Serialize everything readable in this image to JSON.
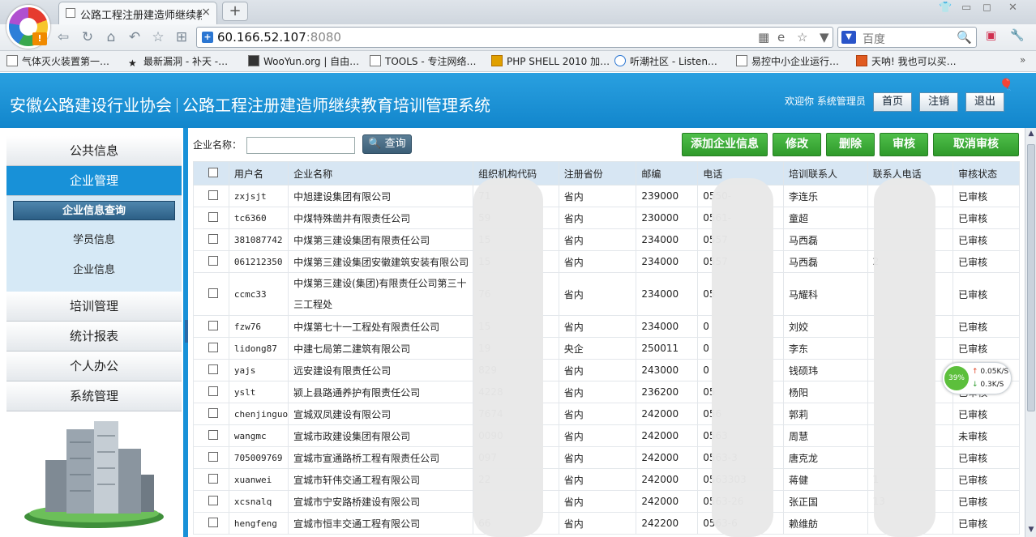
{
  "browser": {
    "tab_title": "公路工程注册建造师继续教",
    "new_tab": "+",
    "close": "×",
    "url_host": "60.166.52.107",
    "url_port": ":8080",
    "search_placeholder": "百度",
    "bookmarks": [
      "气体灭火装置第一…",
      "最新漏洞 - 补天 -…",
      "WooYun.org | 自由…",
      "TOOLS - 专注网络…",
      "PHP SHELL 2010 加…",
      "听潮社区 - Listen…",
      "易控中小企业运行…",
      "天呐! 我也可以买…"
    ]
  },
  "header": {
    "org": "安徽公路建设行业协会",
    "system": "公路工程注册建造师继续教育培训管理系统",
    "welcome": "欢迎你  系统管理员",
    "home_btn": "首页",
    "logout_btn": "注销",
    "exit_btn": "退出"
  },
  "sidebar": {
    "public_info": "公共信息",
    "enterprise_mgmt": "企业管理",
    "sub": {
      "enterprise_query": "企业信息查询",
      "student_info": "学员信息",
      "enterprise_info": "企业信息"
    },
    "training_mgmt": "培训管理",
    "stats": "统计报表",
    "personal": "个人办公",
    "system_mgmt": "系统管理"
  },
  "search": {
    "label": "企业名称：",
    "value": "",
    "query_btn": "查询"
  },
  "actions": {
    "add": "添加企业信息",
    "edit": "修改",
    "delete": "删除",
    "audit": "审核",
    "cancel_audit": "取消审核"
  },
  "table": {
    "headers": [
      "用户名",
      "企业名称",
      "组织机构代码",
      "注册省份",
      "邮编",
      "电话",
      "培训联系人",
      "联系人电话",
      "审核状态"
    ],
    "rows": [
      {
        "user": "zxjsjt",
        "company": "中旭建设集团有限公司",
        "code": "71",
        "prov": "省内",
        "zip": "239000",
        "tel": "0550-",
        "contact": "李连乐",
        "ctel": "",
        "status": "已审核"
      },
      {
        "user": "tc6360",
        "company": "中煤特殊凿井有限责任公司",
        "code": "59",
        "prov": "省内",
        "zip": "230000",
        "tel": "0561-",
        "contact": "童超",
        "ctel": "",
        "status": "已审核"
      },
      {
        "user": "381087742",
        "company": "中煤第三建设集团有限责任公司",
        "code": "15",
        "prov": "省内",
        "zip": "234000",
        "tel": "0557",
        "contact": "马西磊",
        "ctel": "",
        "status": "已审核"
      },
      {
        "user": "061212350",
        "company": "中煤第三建设集团安徽建筑安装有限公司",
        "code": "15",
        "prov": "省内",
        "zip": "234000",
        "tel": "0557",
        "contact": "马西磊",
        "ctel": "2",
        "status": "已审核"
      },
      {
        "user": "ccmc33",
        "company": "中煤第三建设(集团)有限责任公司第三十三工程处",
        "code": "76",
        "prov": "省内",
        "zip": "234000",
        "tel": "05",
        "contact": "马耀科",
        "ctel": "",
        "status": "已审核"
      },
      {
        "user": "fzw76",
        "company": "中煤第七十一工程处有限责任公司",
        "code": "15",
        "prov": "省内",
        "zip": "234000",
        "tel": "0",
        "contact": "刘姣",
        "ctel": "",
        "status": "已审核"
      },
      {
        "user": "lidong87",
        "company": "中建七局第二建筑有限公司",
        "code": "19",
        "prov": "央企",
        "zip": "250011",
        "tel": "0",
        "contact": "李东",
        "ctel": "",
        "status": "已审核"
      },
      {
        "user": "yajs",
        "company": "远安建设有限责任公司",
        "code": "829",
        "prov": "省内",
        "zip": "243000",
        "tel": "0",
        "contact": "钱硕玮",
        "ctel": "",
        "status": "已审核"
      },
      {
        "user": "yslt",
        "company": "颍上县路通养护有限责任公司",
        "code": "4228",
        "prov": "省内",
        "zip": "236200",
        "tel": "05",
        "contact": "杨阳",
        "ctel": "",
        "status": "已审核"
      },
      {
        "user": "chenjinguo",
        "company": "宣城双凤建设有限公司",
        "code": "7674",
        "prov": "省内",
        "zip": "242000",
        "tel": "056",
        "contact": "郭莉",
        "ctel": "",
        "status": "已审核"
      },
      {
        "user": "wangmc",
        "company": "宣城市政建设集团有限公司",
        "code": "0090",
        "prov": "省内",
        "zip": "242000",
        "tel": "0563",
        "contact": "周慧",
        "ctel": "",
        "status": "未审核"
      },
      {
        "user": "705009769",
        "company": "宣城市宣通路桥工程有限责任公司",
        "code": "097",
        "prov": "省内",
        "zip": "242000",
        "tel": "0563-3",
        "contact": "唐克龙",
        "ctel": "",
        "status": "已审核"
      },
      {
        "user": "xuanwei",
        "company": "宣城市轩伟交通工程有限公司",
        "code": "22",
        "prov": "省内",
        "zip": "242000",
        "tel": "0563303",
        "contact": "蒋健",
        "ctel": "1",
        "status": "已审核"
      },
      {
        "user": "xcsnalq",
        "company": "宣城市宁安路桥建设有限公司",
        "code": "",
        "prov": "省内",
        "zip": "242000",
        "tel": "0563-26",
        "contact": "张正国",
        "ctel": "13",
        "status": "已审核"
      },
      {
        "user": "hengfeng",
        "company": "宣城市恒丰交通工程有限公司",
        "code": "66",
        "prov": "省内",
        "zip": "242200",
        "tel": "0563-6",
        "contact": "赖维舫",
        "ctel": "",
        "status": "已审核"
      }
    ]
  },
  "netmon": {
    "pct": "39%",
    "up": "0.05K/S",
    "down": "0.3K/S"
  }
}
